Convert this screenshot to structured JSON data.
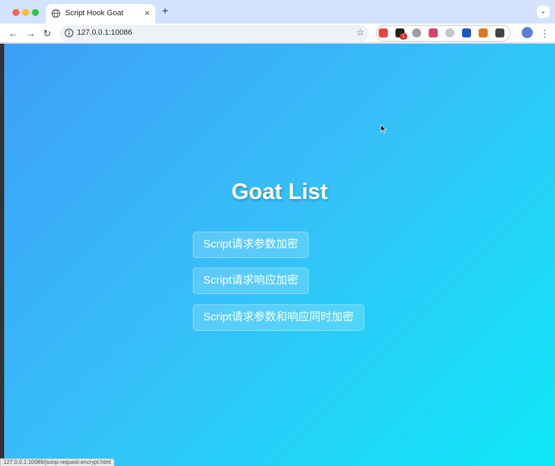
{
  "browser": {
    "tab": {
      "title": "Script Hook Goat",
      "close": "×"
    },
    "new_tab": "+",
    "tab_menu": "⌄",
    "nav": {
      "back": "←",
      "forward": "→",
      "reload": "↻"
    },
    "address": {
      "url": "127.0.0.1:10086",
      "star": "☆"
    },
    "extensions": [
      {
        "name": "ext-fe-icon",
        "color": "#e8453c"
      },
      {
        "name": "ext-dark-icon",
        "color": "#222222"
      },
      {
        "name": "ext-circle-icon",
        "color": "#9aa0a6"
      },
      {
        "name": "ext-red-icon",
        "color": "#d9426b"
      },
      {
        "name": "ext-gray-icon",
        "color": "#c4c7cc"
      },
      {
        "name": "ext-blue-y-icon",
        "color": "#1a56c8"
      },
      {
        "name": "ext-fox-icon",
        "color": "#e2761b"
      },
      {
        "name": "extensions-puzzle-icon",
        "color": "#444444"
      }
    ],
    "ext_badge": "1",
    "menu": "⋮",
    "status_url": "127.0.0.1:10086/jsonp-request-encrypt.html"
  },
  "page": {
    "title": "Goat List",
    "links": [
      "Script请求参数加密",
      "Script请求响应加密",
      "Script请求参数和响应同时加密"
    ]
  },
  "colors": {
    "gradient_start": "#3d9ff7",
    "gradient_end": "#0fe9f7",
    "tab_strip": "#d3e3fd"
  }
}
